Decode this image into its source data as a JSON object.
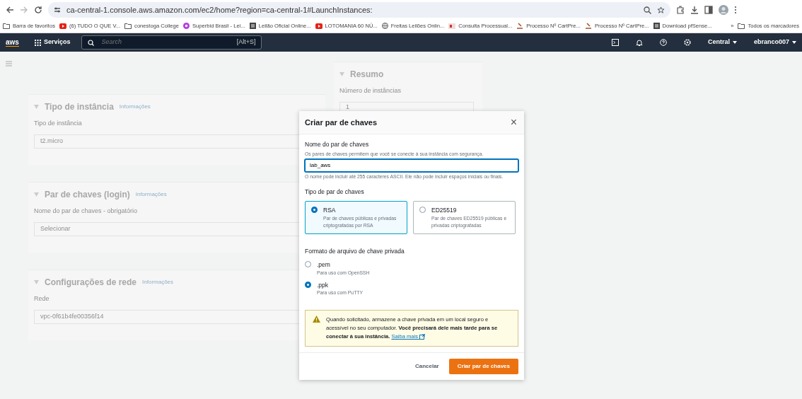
{
  "browser": {
    "url": "ca-central-1.console.aws.amazon.com/ec2/home?region=ca-central-1#LaunchInstances:",
    "bookmarks": [
      {
        "label": "Barra de favoritos"
      },
      {
        "label": "(6) TUDO O QUE V..."
      },
      {
        "label": "conestoga College"
      },
      {
        "label": "Superbid Brasil - Lei..."
      },
      {
        "label": "Leilão Oficial Online..."
      },
      {
        "label": "LOTOMANIA 60 NÚ..."
      },
      {
        "label": "Freitas Leilões Onlin..."
      },
      {
        "label": "Consulta Processual..."
      },
      {
        "label": "Processo Nº CartPre..."
      },
      {
        "label": "Processo Nº CartPre..."
      },
      {
        "label": "Download pfSense..."
      }
    ],
    "overflow": "»",
    "all_bookmarks": "Todos os marcadores"
  },
  "console_nav": {
    "logo": "aws",
    "services": "Serviços",
    "search_placeholder": "Search",
    "shortcut": "[Alt+S]",
    "region": "Central",
    "account": "ebranco007"
  },
  "background": {
    "sections": [
      {
        "title": "Tipo de instância",
        "info": "Informações",
        "label": "Tipo de instância",
        "value": "t2.micro"
      },
      {
        "title": "Par de chaves (login)",
        "info": "Informações",
        "label": "Nome do par de chaves - obrigatório",
        "value": "Selecionar"
      },
      {
        "title": "Configurações de rede",
        "info": "Informações",
        "label": "Rede",
        "value": "vpc-0f61b4fe00356f14"
      }
    ],
    "summary": {
      "title": "Resumo",
      "label": "Número de instâncias",
      "value": "1"
    }
  },
  "modal": {
    "title": "Criar par de chaves",
    "close": "×",
    "name_label": "Nome do par de chaves",
    "name_description": "Os pares de chaves permitem que você se conecte à sua instância com segurança.",
    "name_value": "lab_aws",
    "name_constraint": "O nome pode incluir até 255 caracteres ASCII. Ele não pode incluir espaços iniciais ou finais.",
    "type_label": "Tipo de par de chaves",
    "types": [
      {
        "label": "RSA",
        "description": "Par de chaves públicas e privadas criptografadas por RSA",
        "selected": true
      },
      {
        "label": "ED25519",
        "description": "Par de chaves ED25519 públicas e privadas criptografadas",
        "selected": false
      }
    ],
    "format_label": "Formato de arquivo de chave privada",
    "formats": [
      {
        "label": ".pem",
        "description": "Para uso com OpenSSH",
        "selected": false
      },
      {
        "label": ".ppk",
        "description": "Para uso com PuTTY",
        "selected": true
      }
    ],
    "alert": {
      "text": "Quando solicitado, armazene a chave privada em um local seguro e acessível no seu computador. **Você precisará dele mais tarde para se conectar à sua instância.**",
      "link": "Saiba mais"
    },
    "buttons": [
      {
        "label": "Cancelar",
        "kind": "link"
      },
      {
        "label": "Criar par de chaves",
        "kind": "primary"
      }
    ]
  }
}
